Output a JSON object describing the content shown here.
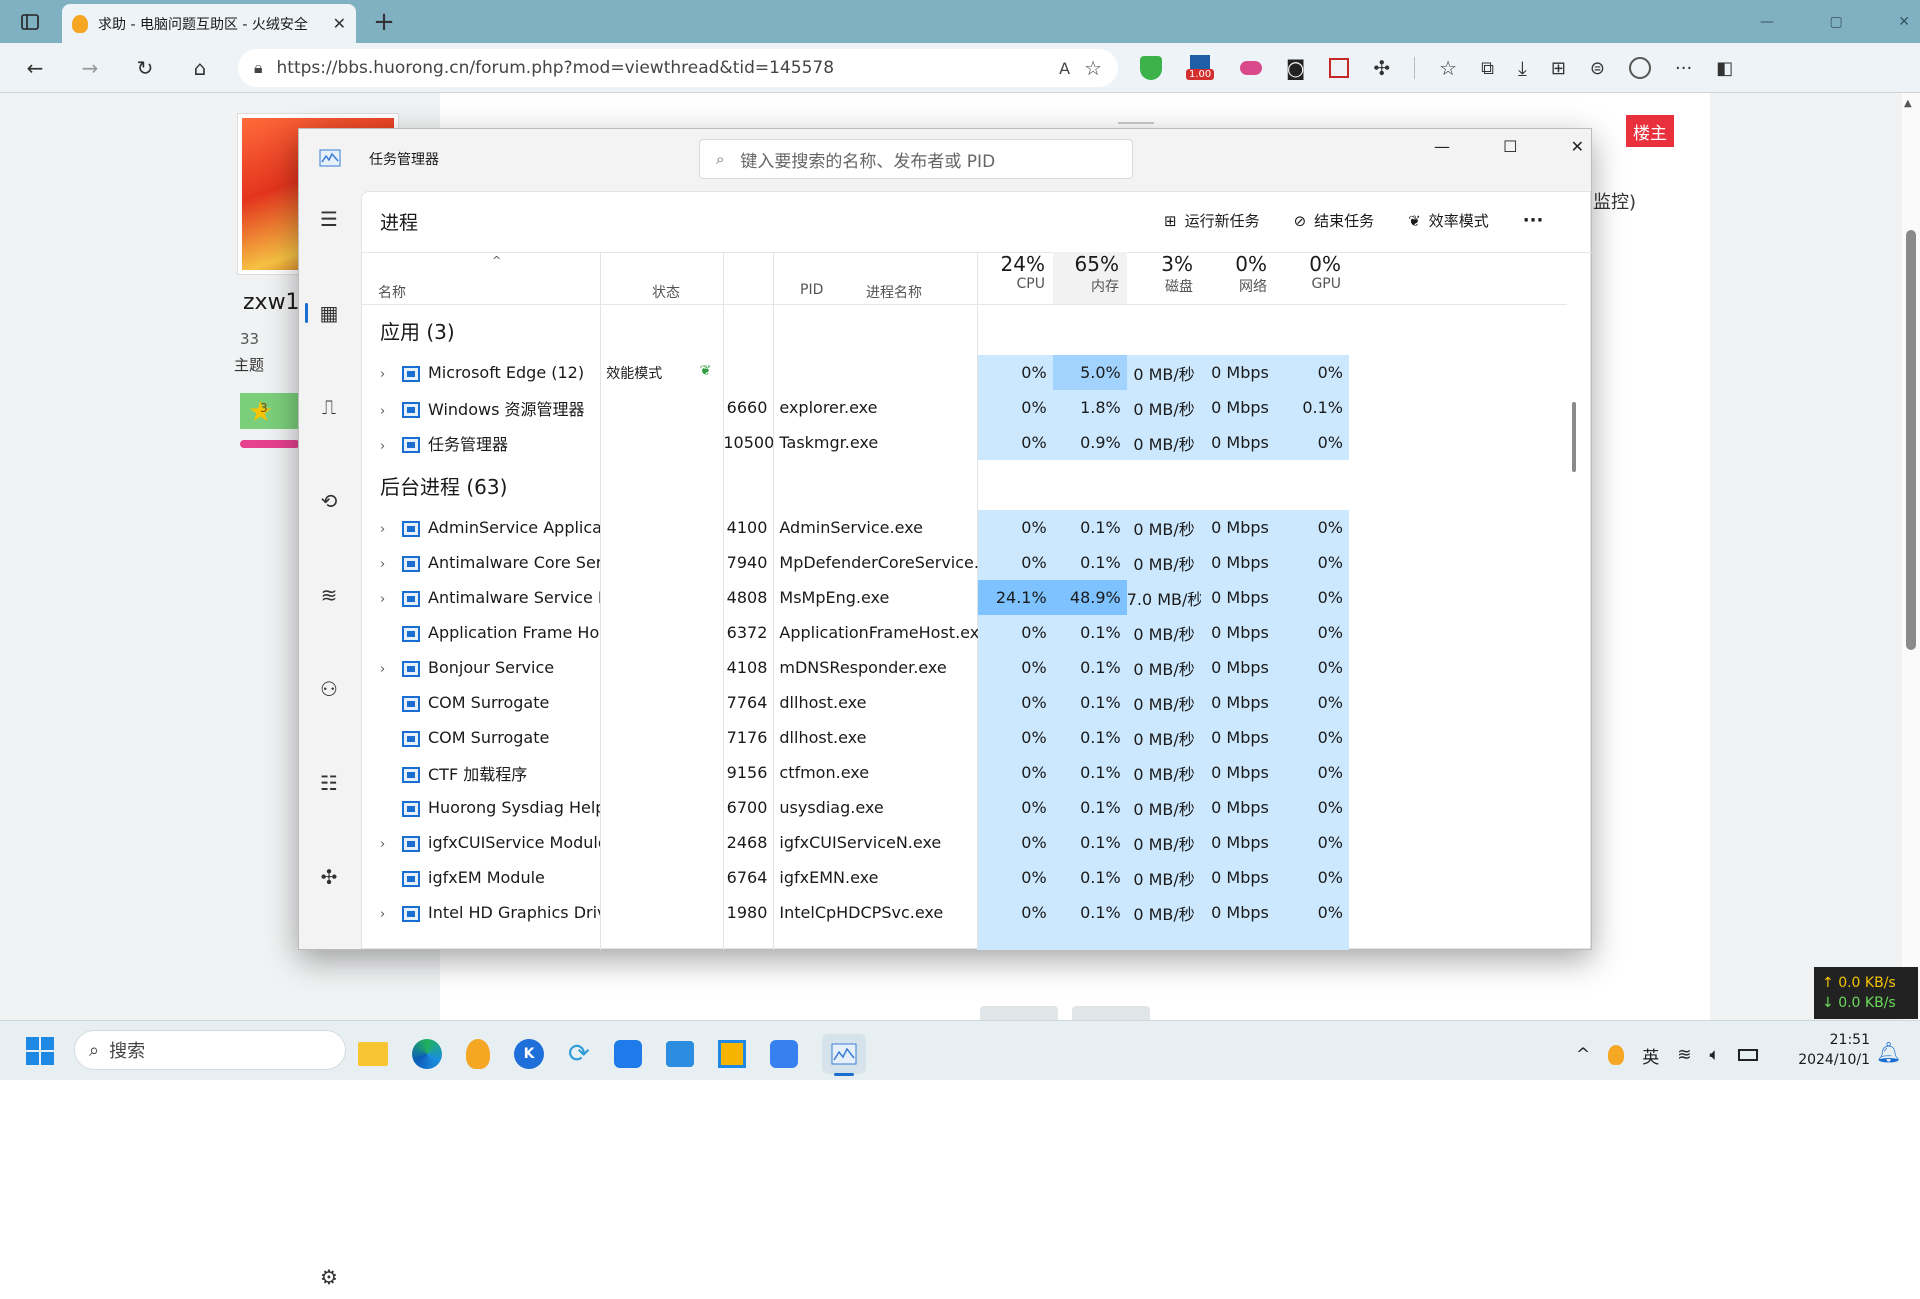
{
  "browser": {
    "tab_title": "求助 - 电脑问题互助区 - 火绒安全",
    "url": "https://bbs.huorong.cn/forum.php?mod=viewthread&tid=145578",
    "badge": "1.00"
  },
  "forum": {
    "username": "zxw17",
    "topics_count": "33",
    "topics_label": "主题",
    "level": "3",
    "owner_badge": "楼主",
    "partial_text": "监控)"
  },
  "taskmgr": {
    "title": "任务管理器",
    "search_placeholder": "键入要搜索的名称、发布者或 PID",
    "page_title": "进程",
    "run_task": "运行新任务",
    "end_task": "结束任务",
    "efficiency_mode": "效率模式",
    "more": "···",
    "col_name": "名称",
    "col_status": "状态",
    "col_pid": "PID",
    "col_proc": "进程名称",
    "cpu_pct": "24%",
    "cpu_label": "CPU",
    "mem_pct": "65%",
    "mem_label": "内存",
    "disk_pct": "3%",
    "disk_label": "磁盘",
    "net_pct": "0%",
    "net_label": "网络",
    "gpu_pct": "0%",
    "gpu_label": "GPU",
    "group_apps": "应用 (3)",
    "group_bg": "后台进程 (63)",
    "apps": [
      {
        "name": "Microsoft Edge (12)",
        "status": "效能模式",
        "pid": "",
        "proc": "",
        "cpu": "0%",
        "mem": "5.0%",
        "disk": "0 MB/秒",
        "net": "0 Mbps",
        "gpu": "0%"
      },
      {
        "name": "Windows 资源管理器",
        "status": "",
        "pid": "6660",
        "proc": "explorer.exe",
        "cpu": "0%",
        "mem": "1.8%",
        "disk": "0 MB/秒",
        "net": "0 Mbps",
        "gpu": "0.1%"
      },
      {
        "name": "任务管理器",
        "status": "",
        "pid": "10500",
        "proc": "Taskmgr.exe",
        "cpu": "0%",
        "mem": "0.9%",
        "disk": "0 MB/秒",
        "net": "0 Mbps",
        "gpu": "0%"
      }
    ],
    "background": [
      {
        "name": "AdminService Application",
        "pid": "4100",
        "proc": "AdminService.exe",
        "cpu": "0%",
        "mem": "0.1%",
        "disk": "0 MB/秒",
        "net": "0 Mbps",
        "gpu": "0%"
      },
      {
        "name": "Antimalware Core Service",
        "pid": "7940",
        "proc": "MpDefenderCoreService.exe",
        "cpu": "0%",
        "mem": "0.1%",
        "disk": "0 MB/秒",
        "net": "0 Mbps",
        "gpu": "0%"
      },
      {
        "name": "Antimalware Service Execu...",
        "pid": "4808",
        "proc": "MsMpEng.exe",
        "cpu": "24.1%",
        "mem": "48.9%",
        "disk": "7.0 MB/秒",
        "net": "0 Mbps",
        "gpu": "0%"
      },
      {
        "name": "Application Frame Host",
        "pid": "6372",
        "proc": "ApplicationFrameHost.exe",
        "cpu": "0%",
        "mem": "0.1%",
        "disk": "0 MB/秒",
        "net": "0 Mbps",
        "gpu": "0%"
      },
      {
        "name": "Bonjour Service",
        "pid": "4108",
        "proc": "mDNSResponder.exe",
        "cpu": "0%",
        "mem": "0.1%",
        "disk": "0 MB/秒",
        "net": "0 Mbps",
        "gpu": "0%"
      },
      {
        "name": "COM Surrogate",
        "pid": "7764",
        "proc": "dllhost.exe",
        "cpu": "0%",
        "mem": "0.1%",
        "disk": "0 MB/秒",
        "net": "0 Mbps",
        "gpu": "0%"
      },
      {
        "name": "COM Surrogate",
        "pid": "7176",
        "proc": "dllhost.exe",
        "cpu": "0%",
        "mem": "0.1%",
        "disk": "0 MB/秒",
        "net": "0 Mbps",
        "gpu": "0%"
      },
      {
        "name": "CTF 加载程序",
        "pid": "9156",
        "proc": "ctfmon.exe",
        "cpu": "0%",
        "mem": "0.1%",
        "disk": "0 MB/秒",
        "net": "0 Mbps",
        "gpu": "0%"
      },
      {
        "name": "Huorong Sysdiag Helper",
        "pid": "6700",
        "proc": "usysdiag.exe",
        "cpu": "0%",
        "mem": "0.1%",
        "disk": "0 MB/秒",
        "net": "0 Mbps",
        "gpu": "0%"
      },
      {
        "name": "igfxCUIService Module",
        "pid": "2468",
        "proc": "igfxCUIServiceN.exe",
        "cpu": "0%",
        "mem": "0.1%",
        "disk": "0 MB/秒",
        "net": "0 Mbps",
        "gpu": "0%"
      },
      {
        "name": "igfxEM Module",
        "pid": "6764",
        "proc": "igfxEMN.exe",
        "cpu": "0%",
        "mem": "0.1%",
        "disk": "0 MB/秒",
        "net": "0 Mbps",
        "gpu": "0%"
      },
      {
        "name": "Intel HD Graphics Drivers f...",
        "pid": "1980",
        "proc": "IntelCpHDCPSvc.exe",
        "cpu": "0%",
        "mem": "0.1%",
        "disk": "0 MB/秒",
        "net": "0 Mbps",
        "gpu": "0%"
      }
    ]
  },
  "netspeed": {
    "up": "0.0 KB/s",
    "down": "0.0 KB/s"
  },
  "taskbar": {
    "search_label": "搜索",
    "ime": "英",
    "time": "21:51",
    "date": "2024/10/1"
  }
}
